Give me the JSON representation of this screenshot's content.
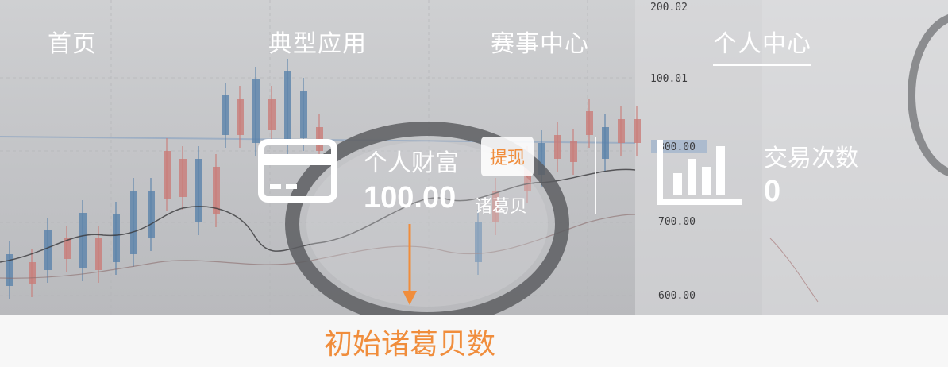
{
  "nav": {
    "items": [
      {
        "label": "首页",
        "active": false
      },
      {
        "label": "典型应用",
        "active": false
      },
      {
        "label": "赛事中心",
        "active": false
      },
      {
        "label": "个人中心",
        "active": true
      }
    ]
  },
  "wealth": {
    "title": "个人财富",
    "amount": "100.00",
    "unit": "诸葛贝",
    "withdraw_label": "提现",
    "icon": "wallet-card-icon"
  },
  "trades": {
    "title": "交易次数",
    "count": "0",
    "icon": "bar-chart-icon"
  },
  "annotation": {
    "text": "初始诸葛贝数",
    "color": "#f08d3c"
  },
  "background": {
    "axis_labels": [
      "200.02",
      "100.01",
      "800.00",
      "700.00",
      "600.00"
    ]
  }
}
